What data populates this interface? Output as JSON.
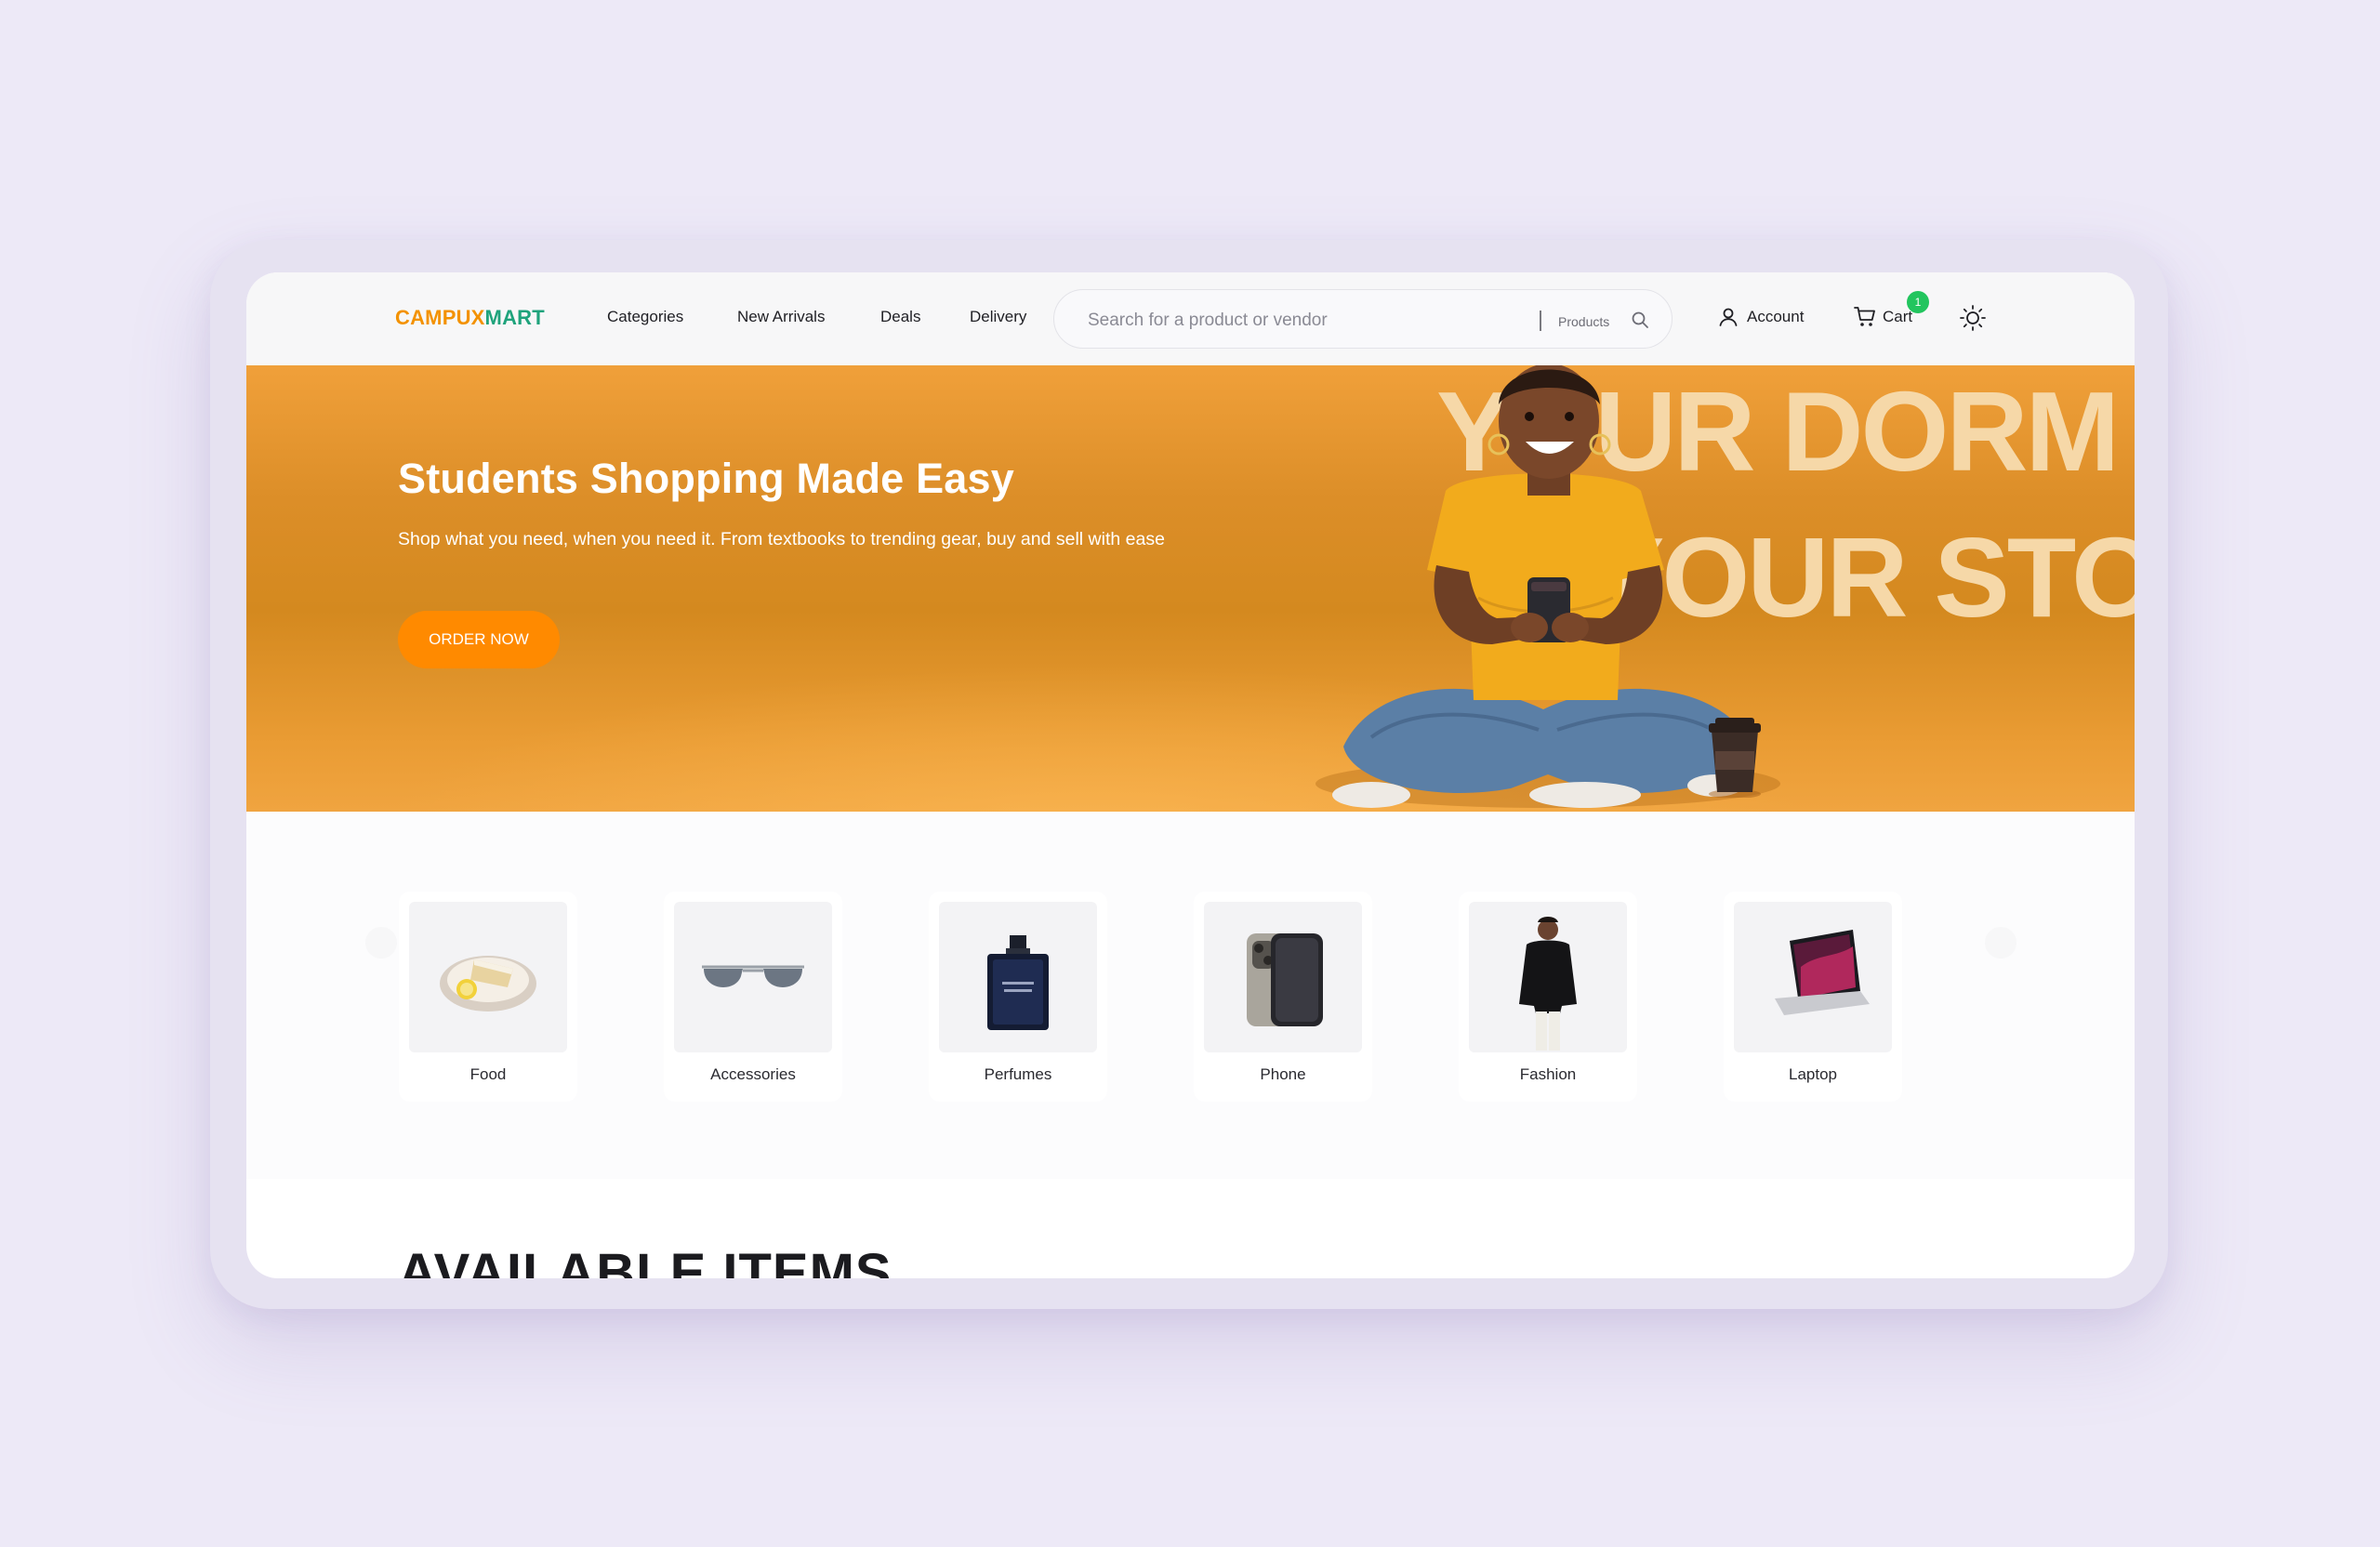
{
  "brand": {
    "part1": "CAMPUX",
    "part2": "MART"
  },
  "nav": {
    "links": [
      "Categories",
      "New Arrivals",
      "Deals",
      "Delivery"
    ],
    "search_placeholder": "Search for a product or vendor",
    "search_scope": "Products",
    "account_label": "Account",
    "cart_label": "Cart",
    "cart_count": "1"
  },
  "hero": {
    "title": "Students Shopping Made Easy",
    "subtitle": "Shop what you need, when you need it. From textbooks to trending gear, buy and sell with ease",
    "cta_label": "ORDER NOW",
    "bg_text_line1": "YOUR DORM",
    "bg_text_line2": "YOUR STORE"
  },
  "categories": [
    {
      "label": "Food",
      "icon": "cake-plate-icon"
    },
    {
      "label": "Accessories",
      "icon": "sunglasses-icon"
    },
    {
      "label": "Perfumes",
      "icon": "perfume-bottle-icon"
    },
    {
      "label": "Phone",
      "icon": "smartphone-icon"
    },
    {
      "label": "Fashion",
      "icon": "fashion-model-icon"
    },
    {
      "label": "Laptop",
      "icon": "laptop-icon"
    }
  ],
  "section_title": "AVAILABLE ITEMS",
  "colors": {
    "brand_orange": "#f39200",
    "brand_green": "#1fa37c",
    "hero_bg": "#dc8e28",
    "cta": "#ff8a00",
    "badge": "#22c55e"
  }
}
